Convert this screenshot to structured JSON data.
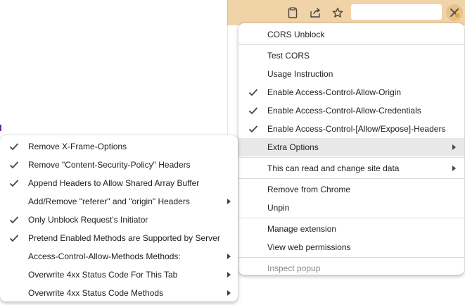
{
  "toolbar": {
    "icons": [
      "clipboard-icon",
      "share-icon",
      "star-icon"
    ],
    "extension_icon": "cors-extension-icon"
  },
  "main_menu": {
    "title": "CORS Unblock",
    "items": [
      {
        "label": "Test CORS",
        "checked": false,
        "submenu": false
      },
      {
        "label": "Usage Instruction",
        "checked": false,
        "submenu": false
      },
      {
        "label": "Enable Access-Control-Allow-Origin",
        "checked": true,
        "submenu": false
      },
      {
        "label": "Enable Access-Control-Allow-Credentials",
        "checked": true,
        "submenu": false
      },
      {
        "label": "Enable Access-Control-[Allow/Expose]-Headers",
        "checked": true,
        "submenu": false
      },
      {
        "label": "Extra Options",
        "checked": false,
        "submenu": true,
        "highlighted": true
      }
    ],
    "site_data": "This can read and change site data",
    "remove": "Remove from Chrome",
    "unpin": "Unpin",
    "manage": "Manage extension",
    "permissions": "View web permissions",
    "inspect": "Inspect popup"
  },
  "sub_menu": {
    "items": [
      {
        "label": "Remove X-Frame-Options",
        "checked": true,
        "submenu": false
      },
      {
        "label": "Remove \"Content-Security-Policy\" Headers",
        "checked": true,
        "submenu": false
      },
      {
        "label": "Append Headers to Allow Shared Array Buffer",
        "checked": true,
        "submenu": false
      },
      {
        "label": "Add/Remove \"referer\" and \"origin\" Headers",
        "checked": false,
        "submenu": true
      },
      {
        "label": "Only Unblock Request's Initiator",
        "checked": true,
        "submenu": false
      },
      {
        "label": "Pretend Enabled Methods are Supported by Server",
        "checked": true,
        "submenu": false
      },
      {
        "label": "Access-Control-Allow-Methods Methods:",
        "checked": false,
        "submenu": true
      },
      {
        "label": "Overwrite 4xx Status Code For This Tab",
        "checked": false,
        "submenu": true
      },
      {
        "label": "Overwrite 4xx Status Code Methods",
        "checked": false,
        "submenu": true
      }
    ]
  },
  "colors": {
    "toolbar_bg": "#f1d3a8",
    "highlight": "#e8e8e8",
    "text": "#202124",
    "disabled_text": "#8a8a8a"
  }
}
